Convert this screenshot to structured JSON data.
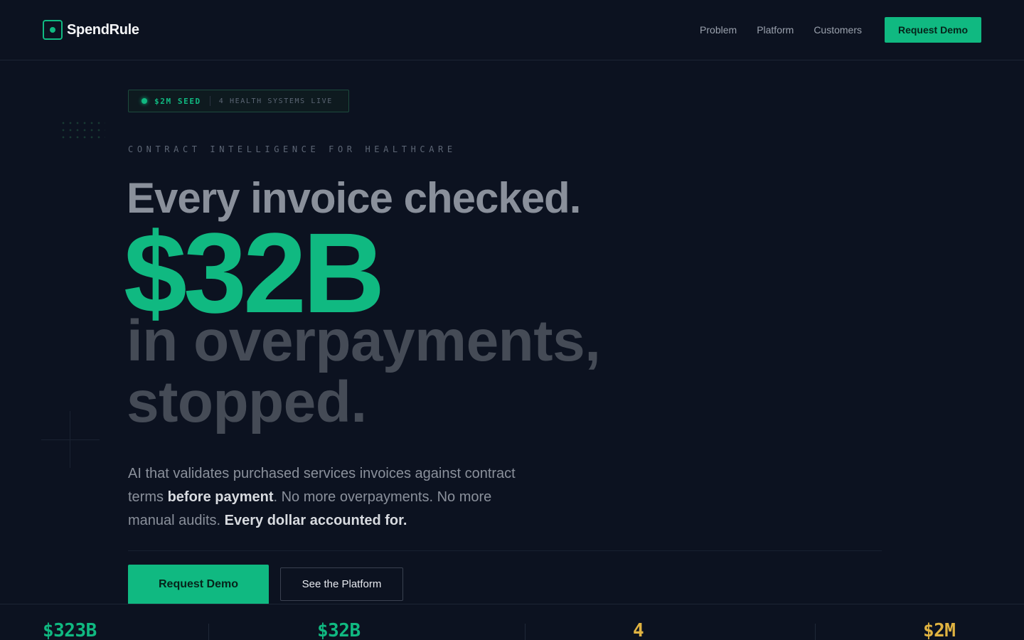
{
  "brand": {
    "name": "SpendRule",
    "accent": "#10b981"
  },
  "nav": {
    "items": [
      "Problem",
      "Platform",
      "Customers"
    ],
    "cta_label": "Request Demo"
  },
  "hero": {
    "badge": {
      "primary": "$2M SEED",
      "secondary": "4 HEALTH SYSTEMS LIVE"
    },
    "eyebrow": "CONTRACT INTELLIGENCE FOR HEALTHCARE",
    "headline": {
      "line1": "Every invoice checked.",
      "big": "$32B",
      "line3": "in overpayments, stopped."
    },
    "lead": {
      "part1": "AI that validates purchased services invoices against contract terms ",
      "bold1": "before payment",
      "part2": ". No more overpayments. No more manual audits. ",
      "bold2": "Every dollar accounted for."
    },
    "primary_cta": "Request Demo",
    "secondary_cta": "See the Platform"
  },
  "stats": [
    {
      "value": "$323B",
      "color": "#10b981"
    },
    {
      "value": "$32B",
      "color": "#10b981"
    },
    {
      "value": "4",
      "color": "#e0b341"
    },
    {
      "value": "$2M",
      "color": "#e0b341"
    }
  ]
}
